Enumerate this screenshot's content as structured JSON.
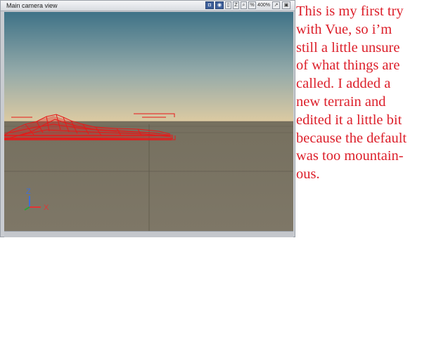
{
  "window": {
    "title": "Main camera view",
    "zoom_label": "400%"
  },
  "toolbar": {
    "icons": [
      "render-icon",
      "camera-icon",
      "split-icon",
      "axis-icon",
      "zoom-icon",
      "percent-icon",
      "pin-icon",
      "maximize-icon"
    ]
  },
  "axes": {
    "z_label": "Z",
    "x_label": "X",
    "colors": {
      "z": "#3d6fd8",
      "x": "#e23434",
      "y": "#2fa23b"
    }
  },
  "annotation": {
    "text": "This is my first try\nwith Vue, so i’m\nstill a little unsure\nof what things are\ncalled. I added a\nnew terrain and\nedited it a little bit\nbecause the default\nwas too mountain-\nous.",
    "color": "#dc1f2a"
  },
  "colors": {
    "terrain": "#e81818",
    "ground": "#7a7364",
    "sky_top": "#3e7287",
    "sky_bottom": "#d9c9a3"
  }
}
